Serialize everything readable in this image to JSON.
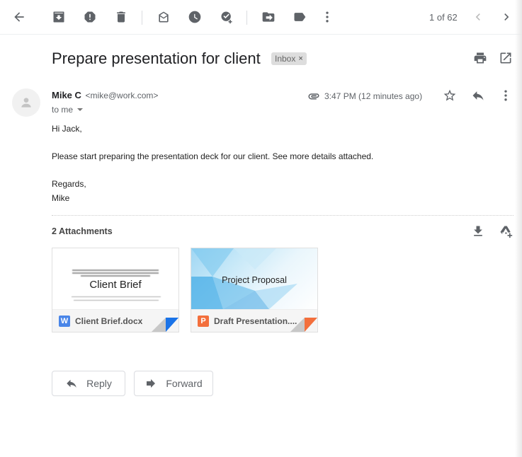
{
  "toolbar": {
    "back": "back",
    "archive": "archive",
    "spam": "report spam",
    "delete": "delete",
    "mark_unread": "mark as unread",
    "snooze": "snooze",
    "add_task": "add to tasks",
    "move": "move to",
    "labels": "labels",
    "more": "more",
    "pager_text": "1 of 62"
  },
  "email": {
    "subject": "Prepare presentation for client",
    "label": "Inbox",
    "label_remove": "×",
    "sender_name": "Mike C",
    "sender_email": "<mike@work.com>",
    "recipient": "to me",
    "timestamp": "3:47 PM (12 minutes ago)",
    "body": {
      "greeting": "Hi Jack,",
      "paragraph": "Please start preparing the presentation deck for our client. See more details attached.",
      "closing": "Regards,",
      "signature": "Mike"
    }
  },
  "attachments": {
    "title": "2 Attachments",
    "items": [
      {
        "name": "Client Brief.docx",
        "type_letter": "W",
        "type_color": "#4a86e8",
        "preview_title": "Client Brief"
      },
      {
        "name": "Draft Presentation....",
        "type_letter": "P",
        "type_color": "#f36f3c",
        "preview_title": "Project Proposal"
      }
    ]
  },
  "actions": {
    "reply": "Reply",
    "forward": "Forward"
  }
}
